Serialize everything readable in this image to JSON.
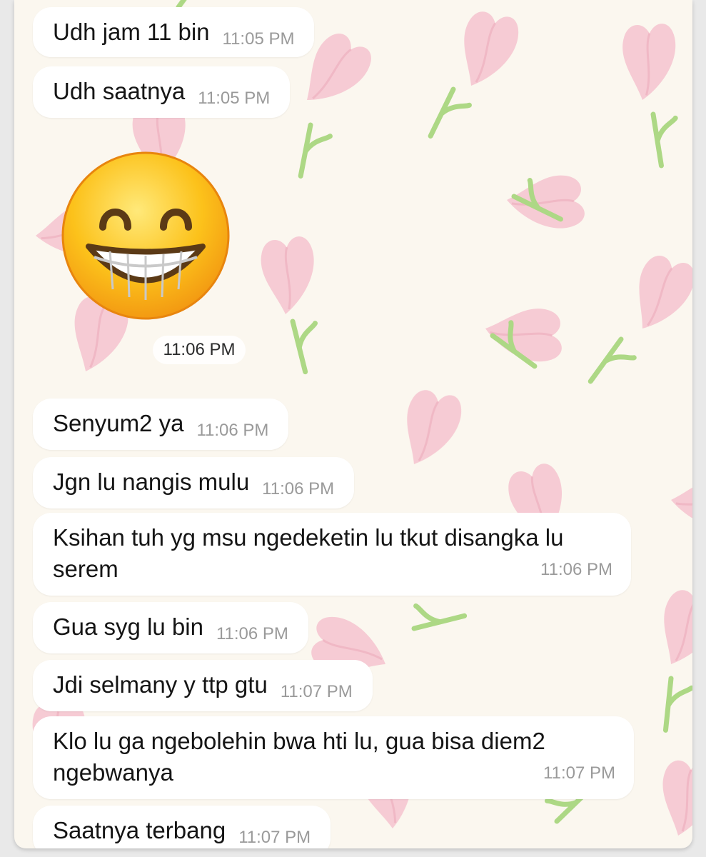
{
  "chat": {
    "messages": [
      {
        "text": "Udh jam 11 bin",
        "time": "11:05 PM"
      },
      {
        "text": "Udh saatnya",
        "time": "11:05 PM"
      },
      {
        "sticker": "grinning-face-with-smiling-eyes-emoji",
        "time": "11:06 PM"
      },
      {
        "text": "Senyum2 ya",
        "time": "11:06 PM"
      },
      {
        "text": "Jgn lu nangis mulu",
        "time": "11:06 PM"
      },
      {
        "text": "Ksihan tuh yg msu ngedeketin lu tkut disangka lu serem",
        "time": "11:06 PM"
      },
      {
        "text": "Gua syg lu bin",
        "time": "11:06 PM"
      },
      {
        "text": "Jdi selmany y ttp gtu",
        "time": "11:07 PM"
      },
      {
        "text": "Klo lu ga ngebolehin bwa hti lu, gua bisa diem2 ngebwanya",
        "time": "11:07 PM"
      },
      {
        "text": "Saatnya terbang",
        "time": "11:07 PM"
      }
    ]
  },
  "colors": {
    "wallpaper_bg": "#fbf7ef",
    "tulip_pink": "#f6c9d2",
    "stem_green": "#a9d67f",
    "bubble_bg": "#ffffff",
    "timestamp_gray": "#9a9a9a"
  }
}
